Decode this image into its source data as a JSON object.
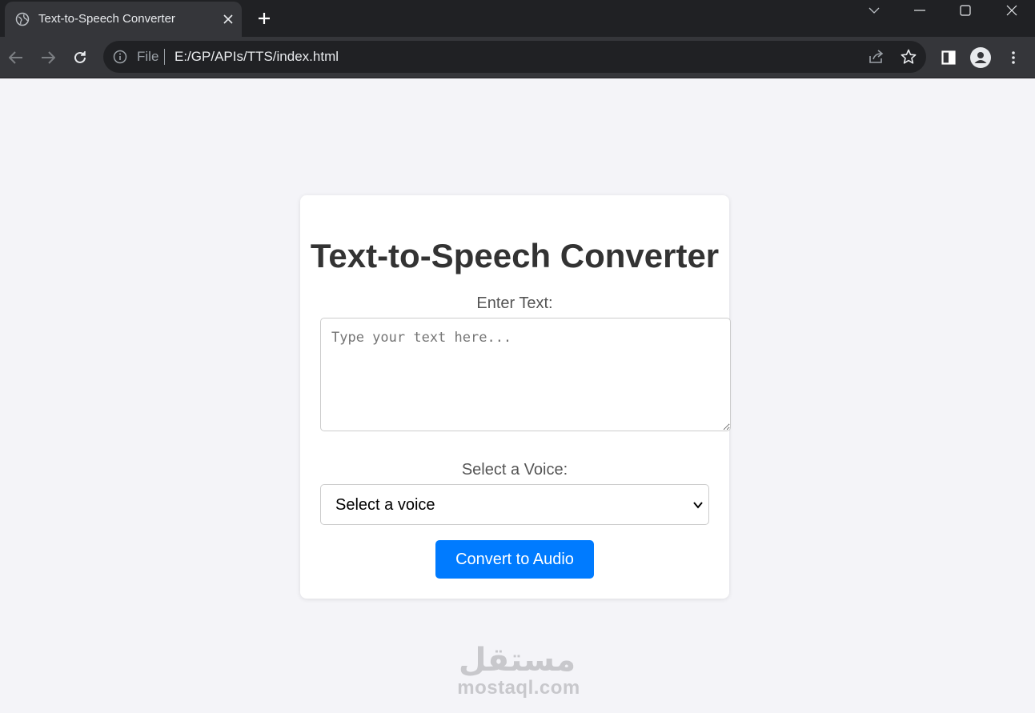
{
  "browser": {
    "tab_title": "Text-to-Speech Converter",
    "address_prefix": "File",
    "url": "E:/GP/APIs/TTS/index.html",
    "icons": [
      "globe-icon",
      "close-icon",
      "plus-icon",
      "chevron-down-icon",
      "minimize-icon",
      "maximize-icon",
      "window-close-icon",
      "back-arrow-icon",
      "forward-arrow-icon",
      "reload-icon",
      "info-icon",
      "share-icon",
      "star-icon",
      "side-panel-icon",
      "profile-icon",
      "kebab-menu-icon"
    ]
  },
  "page": {
    "heading": "Text-to-Speech Converter",
    "text_label": "Enter Text:",
    "text_placeholder": "Type your text here...",
    "text_value": "",
    "voice_label": "Select a Voice:",
    "voice_selected": "Select a voice",
    "convert_button": "Convert to Audio"
  },
  "watermark": {
    "logo_text": "مستقل",
    "text": "mostaql.com"
  },
  "colors": {
    "button": "#007bff",
    "background": "#f4f4f8",
    "chrome_dark": "#202124",
    "chrome_toolbar": "#35363a"
  }
}
